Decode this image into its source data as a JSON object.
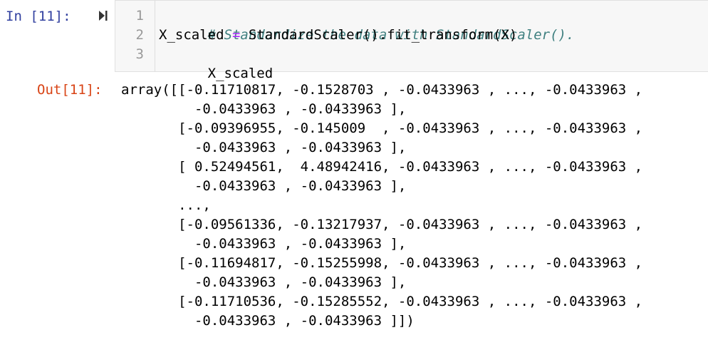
{
  "cell": {
    "in_prompt": "In [11]:",
    "run_icon": "run-to-cursor-icon",
    "line_numbers": [
      "1",
      "2",
      "3"
    ],
    "code": {
      "line1": "# Standardize the data with StandardScaler().",
      "line2_lhs": "X_scaled ",
      "line2_op": "=",
      "line2_rhs": " StandardScaler().fit_transform(X)",
      "line3": "X_scaled"
    },
    "out_prompt": "Out[11]:",
    "output_lines": [
      "array([[-0.11710817, -0.1528703 , -0.0433963 , ..., -0.0433963 ,",
      "         -0.0433963 , -0.0433963 ],",
      "       [-0.09396955, -0.145009  , -0.0433963 , ..., -0.0433963 ,",
      "         -0.0433963 , -0.0433963 ],",
      "       [ 0.52494561,  4.48942416, -0.0433963 , ..., -0.0433963 ,",
      "         -0.0433963 , -0.0433963 ],",
      "       ...,",
      "       [-0.09561336, -0.13217937, -0.0433963 , ..., -0.0433963 ,",
      "         -0.0433963 , -0.0433963 ],",
      "       [-0.11694817, -0.15255998, -0.0433963 , ..., -0.0433963 ,",
      "         -0.0433963 , -0.0433963 ],",
      "       [-0.11710536, -0.15285552, -0.0433963 , ..., -0.0433963 ,",
      "         -0.0433963 , -0.0433963 ]])"
    ]
  }
}
